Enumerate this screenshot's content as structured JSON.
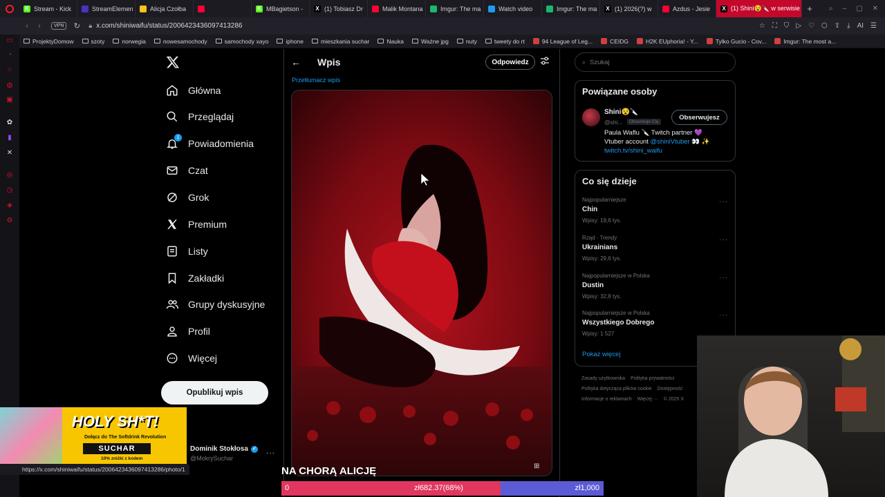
{
  "browser": {
    "tabs": [
      {
        "label": "Stream - Kick",
        "fav_color": "#53fc18",
        "fav_char": "K"
      },
      {
        "label": "StreamElemen",
        "fav_color": "#4b32c3",
        "fav_char": ""
      },
      {
        "label": "Alicja Czołba",
        "fav_color": "#f5c518",
        "fav_char": ""
      },
      {
        "label": "",
        "fav_color": "#ff0033",
        "fav_char": ""
      },
      {
        "label": "MBagietson -",
        "fav_color": "#53fc18",
        "fav_char": "K"
      },
      {
        "label": "(1) Tobiasz Dr",
        "fav_color": "#000000",
        "fav_char": "X"
      },
      {
        "label": "Malik Montana",
        "fav_color": "#ff0033",
        "fav_char": ""
      },
      {
        "label": "Imgur: The ma",
        "fav_color": "#1bb76e",
        "fav_char": ""
      },
      {
        "label": "Watch video",
        "fav_color": "#1d9bf0",
        "fav_char": ""
      },
      {
        "label": "Imgur: The ma",
        "fav_color": "#1bb76e",
        "fav_char": ""
      },
      {
        "label": "(1) 2026(?) w",
        "fav_color": "#000000",
        "fav_char": "X"
      },
      {
        "label": "Azdus - Jesie",
        "fav_color": "#ff0033",
        "fav_char": ""
      }
    ],
    "active_tab": "(1) Shini😵🔪 w serwisie",
    "url": "x.com/shiniwaifu/status/2006423436097413286",
    "vpn": "VPN",
    "ai_label": "AI",
    "bookmarks": [
      {
        "label": "ProjektyDomow",
        "type": "folder"
      },
      {
        "label": "szoty",
        "type": "folder"
      },
      {
        "label": "norwegia",
        "type": "folder"
      },
      {
        "label": "nowesamochody",
        "type": "folder"
      },
      {
        "label": "samochody xayo",
        "type": "folder"
      },
      {
        "label": "iphone",
        "type": "folder"
      },
      {
        "label": "mieszkania suchar",
        "type": "folder"
      },
      {
        "label": "Nauka",
        "type": "folder"
      },
      {
        "label": "Ważne jpg",
        "type": "folder"
      },
      {
        "label": "nuty",
        "type": "folder"
      },
      {
        "label": "tweety do rt",
        "type": "folder"
      },
      {
        "label": "94 League of Leg...",
        "type": "site"
      },
      {
        "label": "CEIDG",
        "type": "site"
      },
      {
        "label": "H2K EUphoria! - Y...",
        "type": "site"
      },
      {
        "label": "Tylko Gucio - Cov...",
        "type": "site"
      },
      {
        "label": "Imgur: The most a...",
        "type": "site"
      }
    ],
    "status_url": "https://x.com/shiniwaifu/status/2006423436097413286/photo/1"
  },
  "sidebar": {
    "nav": [
      {
        "label": "Główna",
        "icon": "home-icon"
      },
      {
        "label": "Przeglądaj",
        "icon": "search-icon"
      },
      {
        "label": "Powiadomienia",
        "icon": "bell-icon",
        "badge": "1"
      },
      {
        "label": "Czat",
        "icon": "mail-icon"
      },
      {
        "label": "Grok",
        "icon": "grok-icon"
      },
      {
        "label": "Premium",
        "icon": "x-logo-icon"
      },
      {
        "label": "Listy",
        "icon": "list-icon"
      },
      {
        "label": "Zakładki",
        "icon": "bookmark-icon"
      },
      {
        "label": "Grupy dyskusyjne",
        "icon": "people-icon"
      },
      {
        "label": "Profil",
        "icon": "person-icon"
      },
      {
        "label": "Więcej",
        "icon": "more-icon"
      }
    ],
    "post_button": "Opublikuj wpis",
    "account": {
      "name": "Dominik Stokłosa",
      "handle": "@MokrySuchar"
    }
  },
  "main": {
    "header_title": "Wpis",
    "reply_button": "Odpowiedz",
    "translate_link": "Przetłumacz wpis"
  },
  "right": {
    "search_placeholder": "Szukaj",
    "related_title": "Powiązane osoby",
    "person": {
      "name": "Shini😵🔪",
      "handle": "@shi...",
      "follows_you": "Obserwuje Cię",
      "follow_button": "Obserwujesz",
      "bio_line1": "Paula Waflu 🔪 Twitch partner 💜",
      "bio_line2_prefix": "Vtuber account ",
      "bio_mention": "@shiniVtuber",
      "bio_line2_suffix": " 👀 ✨",
      "bio_link": "twitch.tv/shini_waifu"
    },
    "trends_title": "Co się dzieje",
    "trends": [
      {
        "meta": "Najpopularniejsze",
        "name": "Chin",
        "count": "Wpisy: 19,6 tys."
      },
      {
        "meta": "Rząd · Trendy",
        "name": "Ukrainians",
        "count": "Wpisy: 29,6 tys."
      },
      {
        "meta": "Najpopularniejsze w Polska",
        "name": "Dustin",
        "count": "Wpisy: 32,8 tys."
      },
      {
        "meta": "Najpopularniejsze w Polska",
        "name": "Wszystkiego Dobrego",
        "count": "Wpisy: 1 527"
      }
    ],
    "show_more": "Pokaż więcej",
    "footer": [
      [
        "Zasady użytkownika",
        "Polityka prywatności"
      ],
      [
        "Polityka dotycząca plików cookie",
        "Dostępność"
      ],
      [
        "Informacje o reklamach",
        "Więcej ···",
        "© 2025 X"
      ]
    ]
  },
  "overlay": {
    "promo_title": "HOLY SH*T!",
    "promo_sub": "Dołącz do The Softdrink Revolution",
    "promo_brand": "SUCHAR",
    "promo_discount": "10% zniżki z kodem",
    "caption": "NA CHORĄ ALICJĘ",
    "progress_start": "0",
    "progress_current": "zł682.37(68%)",
    "progress_end": "zł1,000",
    "progress_fraction": 0.68,
    "colors": {
      "progress_fill": "#e0365f",
      "progress_rest": "#5b5bd6",
      "promo_yellow": "#f7c600"
    }
  }
}
